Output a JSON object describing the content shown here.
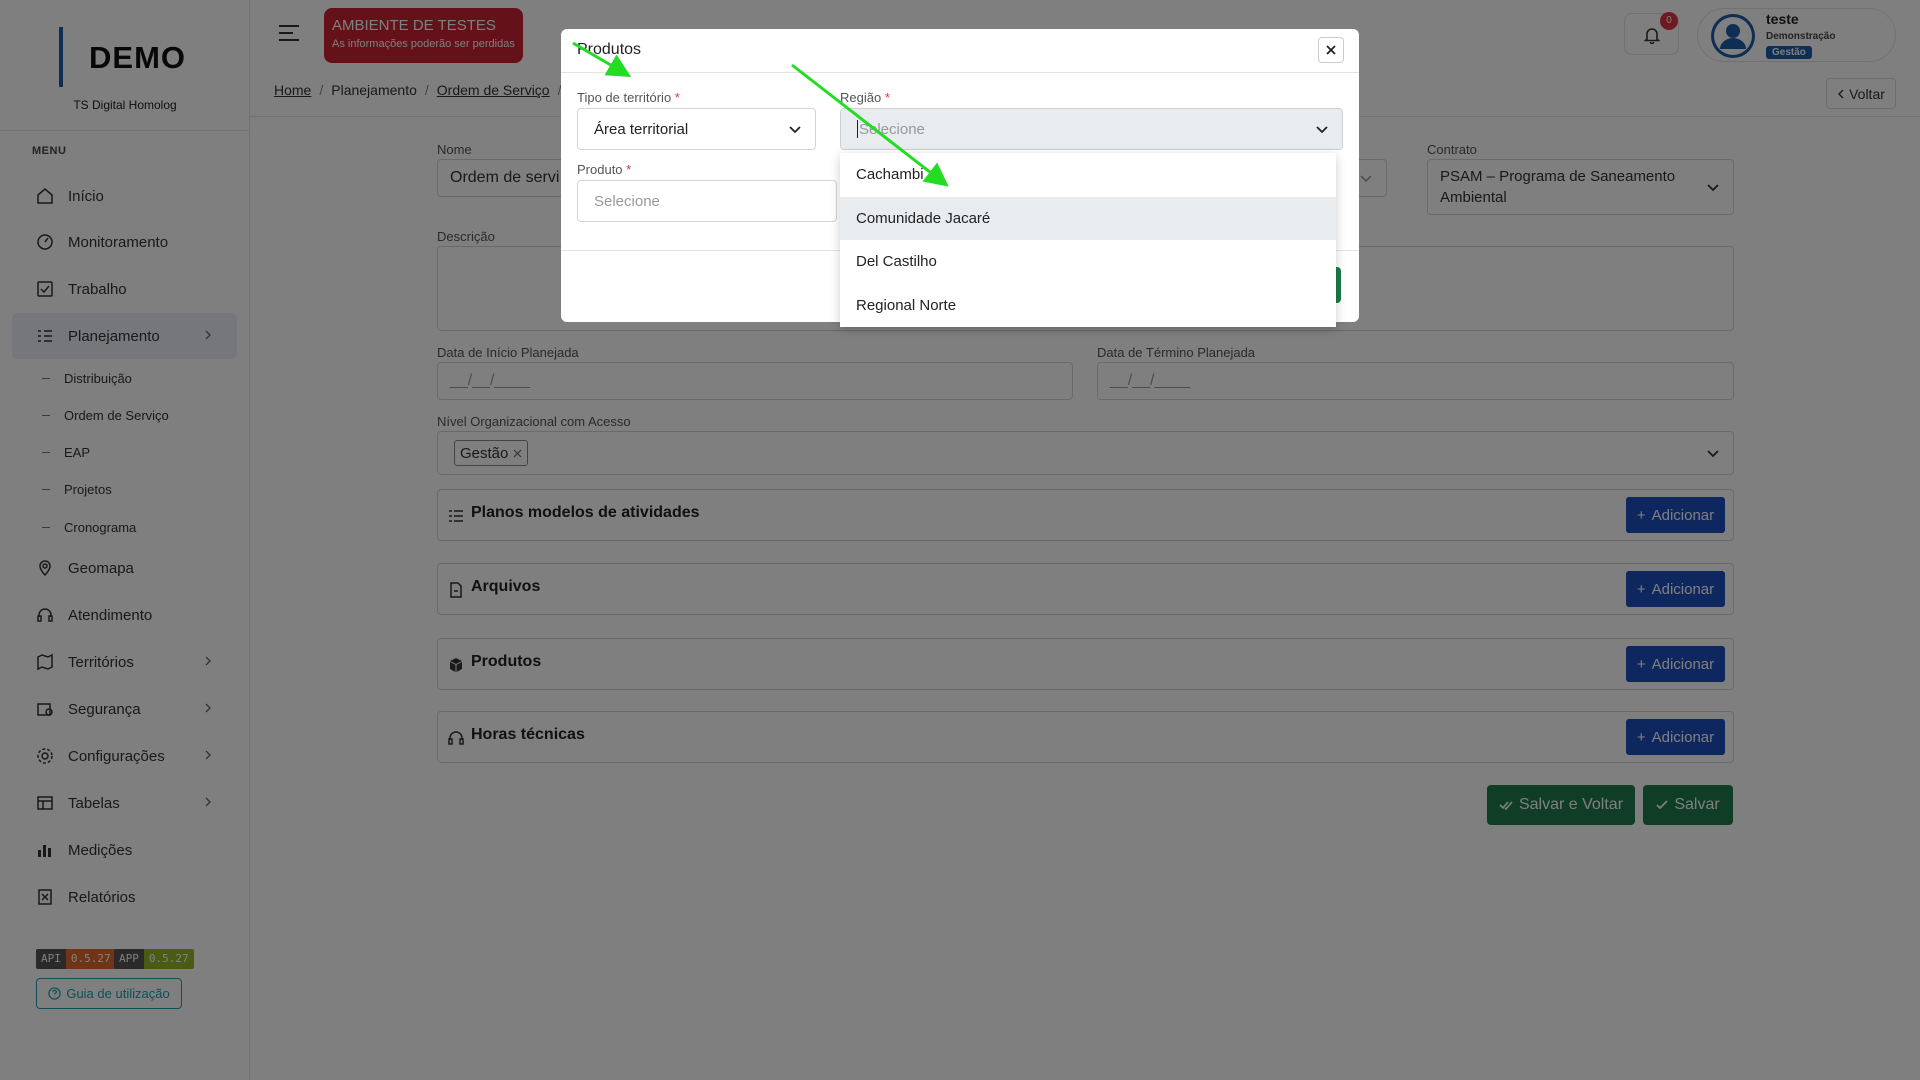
{
  "sidebar": {
    "logo": "DEMO",
    "org": "TS Digital Homolog",
    "menu_label": "MENU",
    "items": [
      {
        "label": "Início",
        "icon": "home-icon"
      },
      {
        "label": "Monitoramento",
        "icon": "speedometer-icon"
      },
      {
        "label": "Trabalho",
        "icon": "checkbox-icon"
      },
      {
        "label": "Planejamento",
        "icon": "list-icon"
      },
      {
        "label": "Geomapa",
        "icon": "pin-icon"
      },
      {
        "label": "Atendimento",
        "icon": "headset-icon"
      },
      {
        "label": "Territórios",
        "icon": "map-icon"
      },
      {
        "label": "Segurança",
        "icon": "lock-icon"
      },
      {
        "label": "Configurações",
        "icon": "gear-icon"
      },
      {
        "label": "Tabelas",
        "icon": "table-icon"
      },
      {
        "label": "Medições",
        "icon": "bar-chart-icon"
      },
      {
        "label": "Relatórios",
        "icon": "report-icon"
      }
    ],
    "sub_items": [
      "Distribuição",
      "Ordem de Serviço",
      "EAP",
      "Projetos",
      "Cronograma"
    ],
    "version": {
      "api_key": "API",
      "api_val": "0.5.27",
      "app_key": "APP",
      "app_val": "0.5.27"
    },
    "guide": "Guia de utilização"
  },
  "header": {
    "env_title": "AMBIENTE DE TESTES",
    "env_sub": "As informações poderão ser perdidas",
    "notifications": "0",
    "user_name": "teste",
    "user_role": "Demonstração",
    "user_tag": "Gestão",
    "breadcrumb": [
      "Home",
      "Planejamento",
      "Ordem de Serviço"
    ],
    "back": "Voltar"
  },
  "form": {
    "nome_label": "Nome",
    "nome_value": "Ordem de servi",
    "contrato_label": "Contrato",
    "contrato_value": "PSAM – Programa de Saneamento Ambiental",
    "descricao_label": "Descrição",
    "inicio_label": "Data de Início Planejada",
    "inicio_ph": "__/__/____",
    "termino_label": "Data de Término Planejada",
    "termino_ph": "__/__/____",
    "nivel_label": "Nível Organizacional com Acesso",
    "nivel_chip": "Gestão",
    "sections": [
      {
        "title": "Planos modelos de atividades",
        "icon": "list-icon"
      },
      {
        "title": "Arquivos",
        "icon": "file-icon"
      },
      {
        "title": "Produtos",
        "icon": "box-icon"
      },
      {
        "title": "Horas técnicas",
        "icon": "headset-icon"
      }
    ],
    "add_label": "Adicionar",
    "save_back": "Salvar e Voltar",
    "save": "Salvar"
  },
  "modal": {
    "title": "Produtos",
    "tipo_label": "Tipo de território",
    "tipo_value": "Área territorial",
    "regiao_label": "Região",
    "regiao_ph": "Selecione",
    "produto_label": "Produto",
    "produto_ph": "Selecione",
    "required_mark": "*",
    "options": [
      "Cachambi",
      "Comunidade Jacaré",
      "Del Castilho",
      "Regional Norte"
    ]
  },
  "colors": {
    "env": "#c82333",
    "primary": "#1f4fbf",
    "success": "#1e7a4a",
    "arrow": "#22dd22"
  }
}
